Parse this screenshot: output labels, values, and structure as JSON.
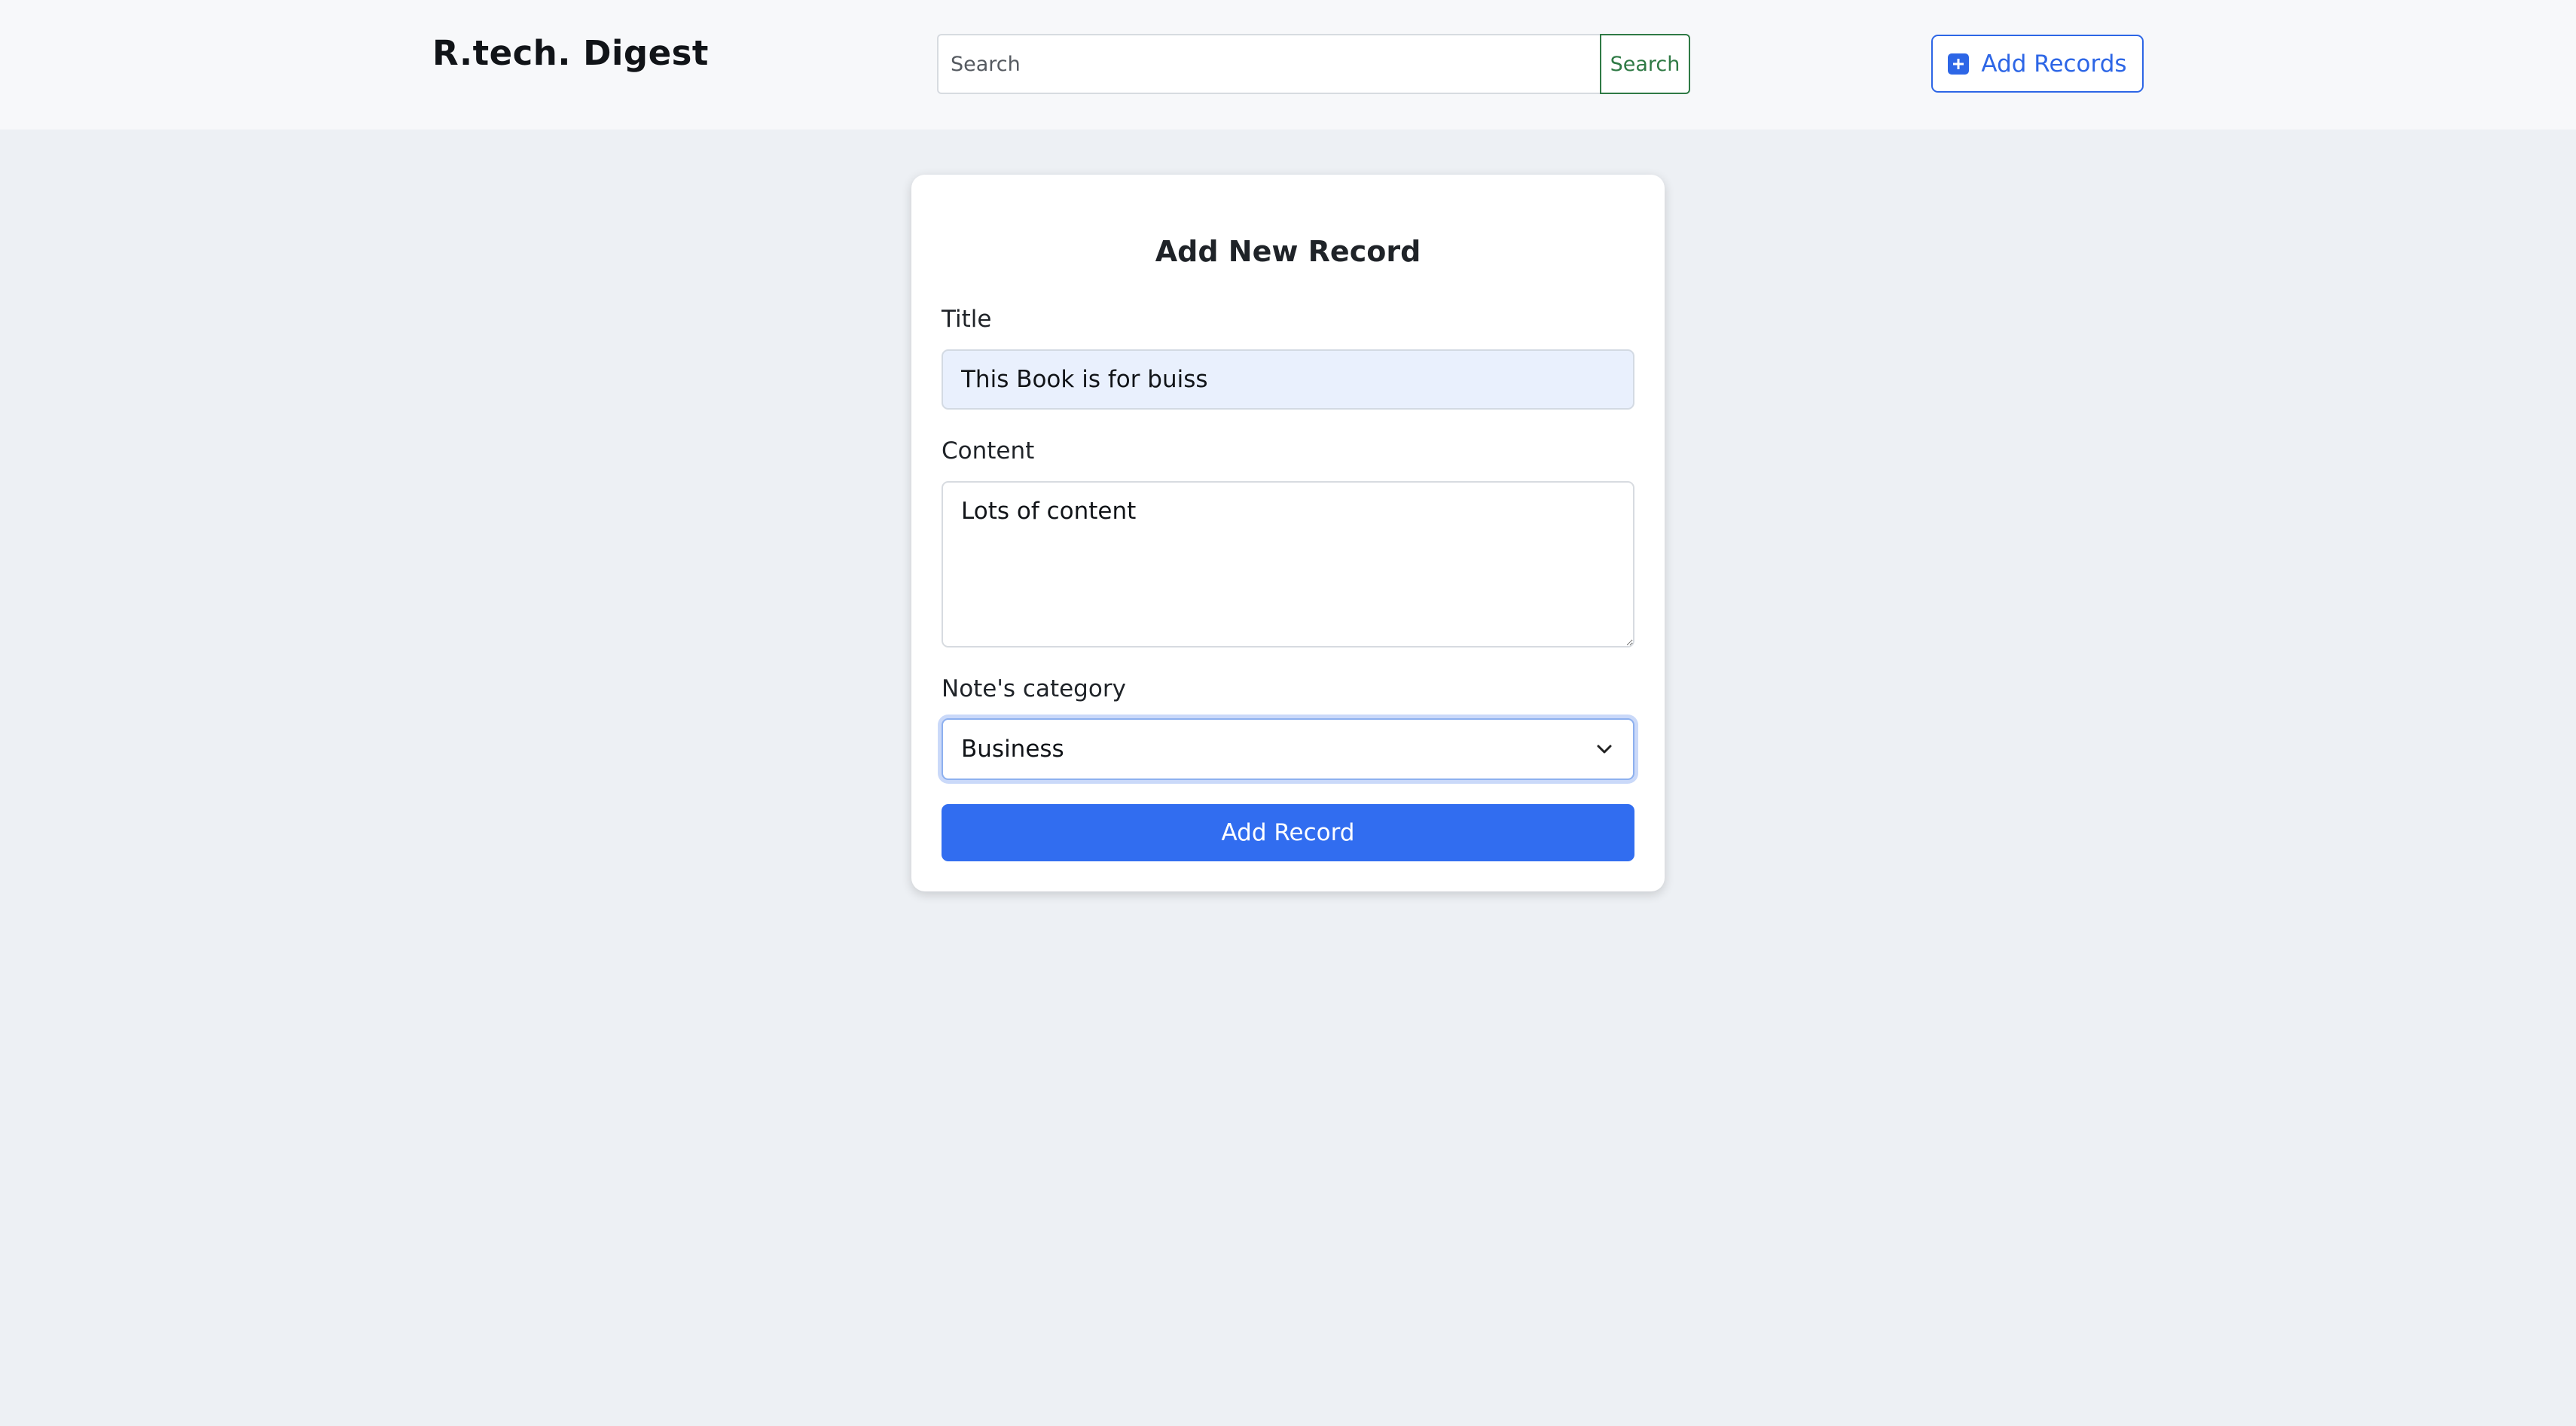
{
  "navbar": {
    "brand": "R.tech. Digest",
    "search": {
      "placeholder": "Search",
      "value": "",
      "button_label": "Search"
    },
    "add_records_label": "Add Records",
    "add_records_icon": "plus-square-icon"
  },
  "form": {
    "title": "Add New Record",
    "title_field": {
      "label": "Title",
      "value": "This Book is for buiss"
    },
    "content_field": {
      "label": "Content",
      "value": "Lots of content"
    },
    "category_field": {
      "label": "Note's category",
      "selected": "Business",
      "icon": "chevron-down-icon"
    },
    "submit_label": "Add Record"
  },
  "colors": {
    "primary": "#316df0",
    "success": "#2f7a45",
    "background": "#edf0f4",
    "navbar": "#f7f8fa",
    "title_input_bg": "#e9f0fd"
  }
}
